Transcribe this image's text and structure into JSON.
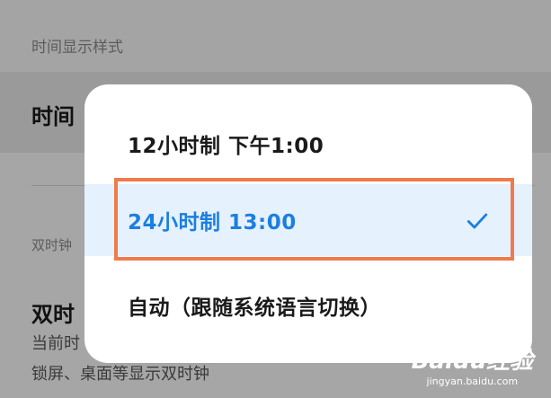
{
  "background": {
    "section_time_style": "时间显示样式",
    "row_time_partial": "时间",
    "section_dual_clock_partial": "双时钟",
    "row_dual_clock_partial": "双时",
    "row_dual_clock_sub_partial": "当前时",
    "row_dual_clock_desc": "锁屏、桌面等显示双时钟"
  },
  "dialog": {
    "options": [
      {
        "label": "12小时制 下午1:00",
        "selected": false
      },
      {
        "label": "24小时制 13:00",
        "selected": true
      },
      {
        "label": "自动（跟随系统语言切换）",
        "selected": false
      }
    ],
    "selected_icon": "checkmark-icon",
    "accent_color": "#1b7fe0",
    "highlight_color": "#ef7b4c"
  },
  "watermark": {
    "brand": "Baidu经验",
    "url": "jingyan.baidu.com"
  }
}
